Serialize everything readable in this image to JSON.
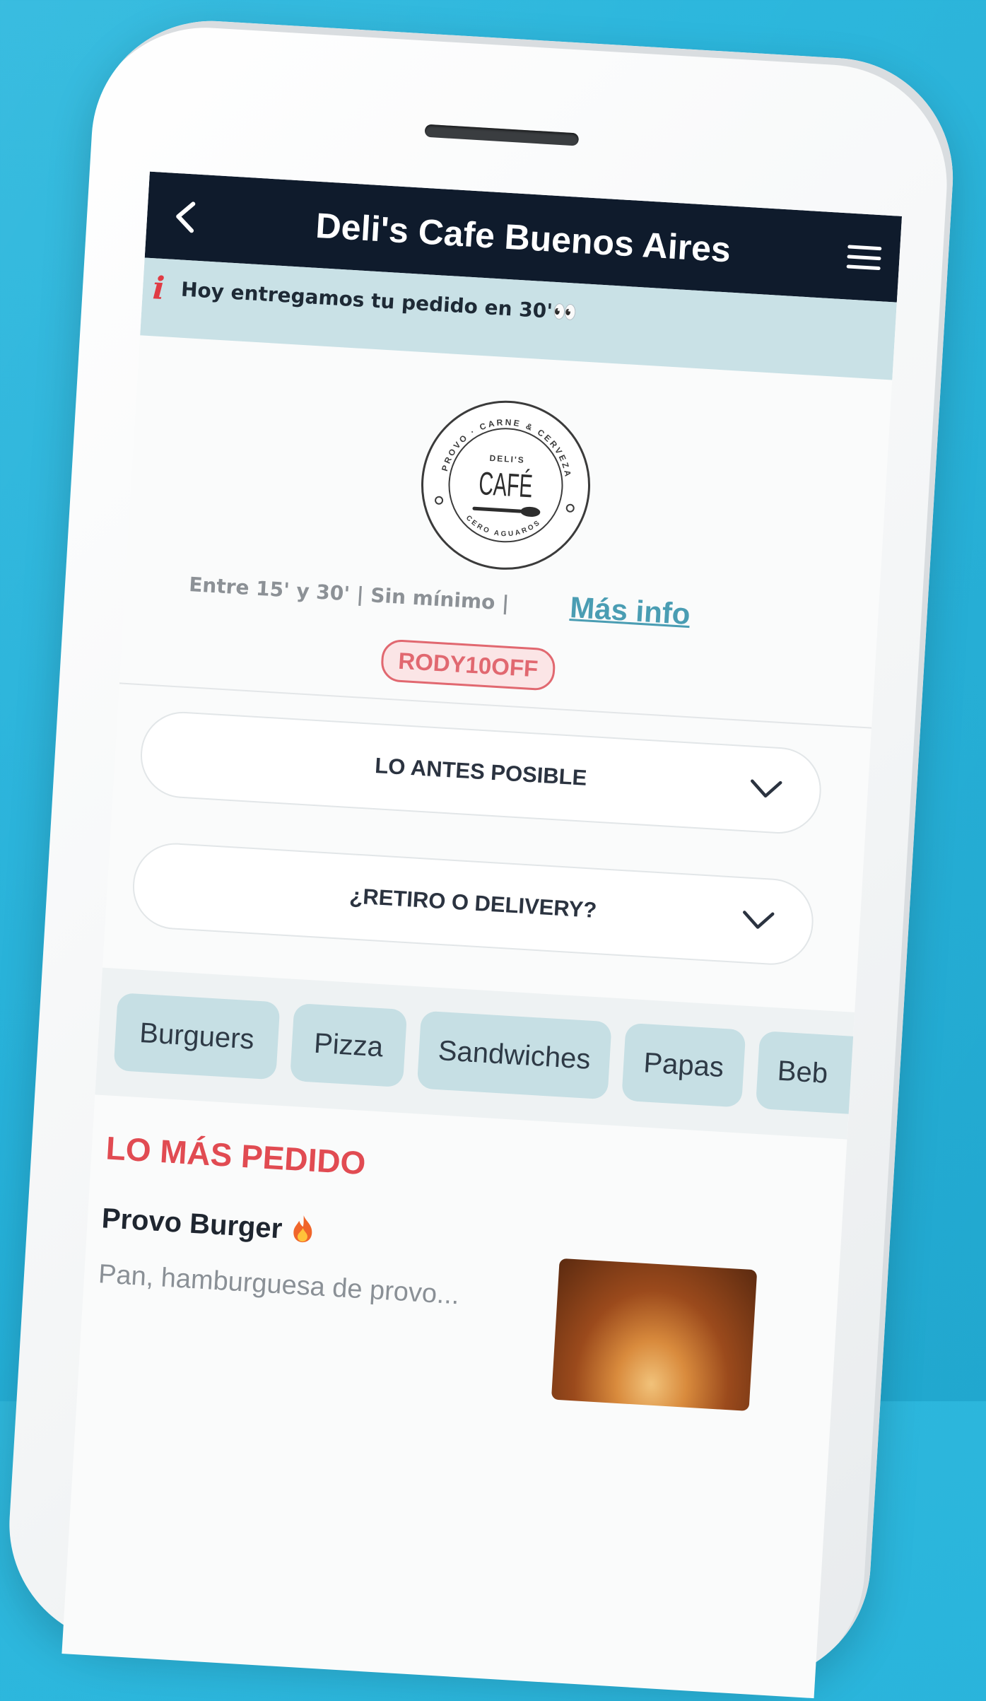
{
  "header": {
    "title": "Deli's Cafe Buenos Aires",
    "back_icon": "chevron-left-icon",
    "menu_icon": "hamburger-menu-icon"
  },
  "notice": {
    "icon": "info-icon",
    "icon_glyph": "i",
    "text": "Hoy entregamos tu pedido en 30'👀"
  },
  "store": {
    "logo": {
      "top_text": "PROVO · CARNE & CERVEZA",
      "brand_small": "DELI'S",
      "brand_big": "CAFÉ",
      "bottom_text": "CERO AGUAROS"
    },
    "meta": "Entre 15' y 30' | Sin mínimo |",
    "more_info": "Más info",
    "promo_code": "RODY10OFF"
  },
  "selectors": [
    {
      "label": "LO ANTES POSIBLE",
      "icon": "chevron-down-icon"
    },
    {
      "label": "¿RETIRO O DELIVERY?",
      "icon": "chevron-down-icon"
    }
  ],
  "categories": [
    "Burguers",
    "Pizza",
    "Sandwiches",
    "Papas",
    "Beb"
  ],
  "section": {
    "title": "LO MÁS PEDIDO"
  },
  "product": {
    "name": "Provo Burger",
    "badge_icon": "fire-icon",
    "description": "Pan, hamburguesa de provo..."
  },
  "colors": {
    "background": "#2fb9de",
    "topbar": "#0f1b2c",
    "notice_bg": "#c9e1e6",
    "accent_red": "#e14b52",
    "link": "#4a9db3",
    "chip_bg": "#c6dfe4"
  }
}
